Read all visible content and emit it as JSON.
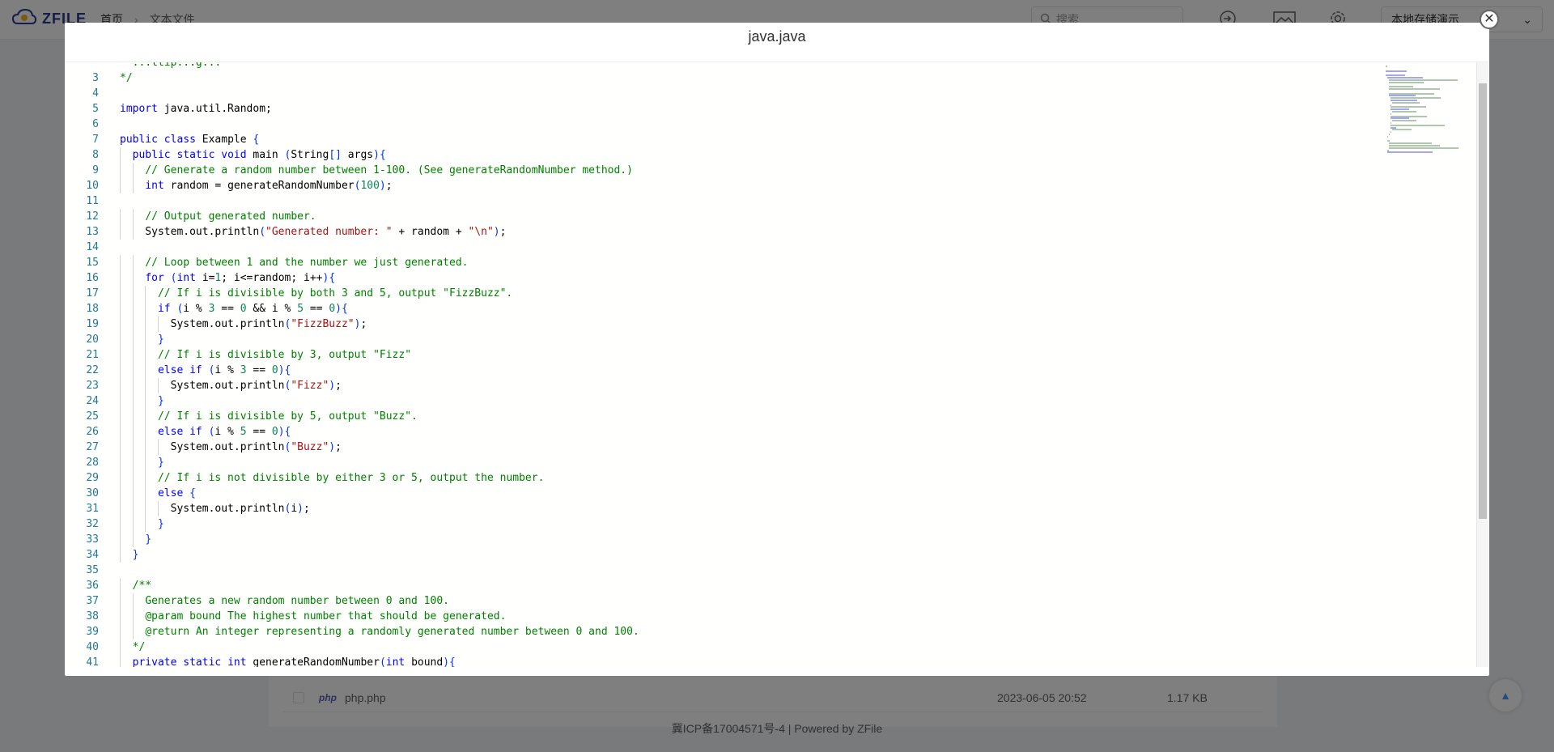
{
  "app": {
    "logo_text": "ZFILE",
    "breadcrumb": [
      "首页",
      "文本文件"
    ],
    "search_placeholder": "搜索",
    "storage_selected": "本地存储演示"
  },
  "file_row": {
    "icon_label": "php",
    "name": "php.php",
    "date": "2023-06-05 20:52",
    "size": "1.17 KB"
  },
  "footer": {
    "text": "冀ICP备17004571号-4 | Powered by ZFile"
  },
  "dialog": {
    "title": "java.java",
    "close_icon": "close-icon"
  },
  "editor": {
    "language": "java",
    "first_line_partial": "* ...ttip...g...",
    "lines": [
      {
        "n": "3",
        "t": "*/"
      },
      {
        "n": "4",
        "t": ""
      },
      {
        "n": "5",
        "t": "import java.util.Random;"
      },
      {
        "n": "6",
        "t": ""
      },
      {
        "n": "7",
        "t": "public class Example {"
      },
      {
        "n": "8",
        "t": "  public static void main (String[] args){"
      },
      {
        "n": "9",
        "t": "    // Generate a random number between 1-100. (See generateRandomNumber method.)"
      },
      {
        "n": "10",
        "t": "    int random = generateRandomNumber(100);"
      },
      {
        "n": "11",
        "t": ""
      },
      {
        "n": "12",
        "t": "    // Output generated number."
      },
      {
        "n": "13",
        "t": "    System.out.println(\"Generated number: \" + random + \"\\n\");"
      },
      {
        "n": "14",
        "t": ""
      },
      {
        "n": "15",
        "t": "    // Loop between 1 and the number we just generated."
      },
      {
        "n": "16",
        "t": "    for (int i=1; i<=random; i++){"
      },
      {
        "n": "17",
        "t": "      // If i is divisible by both 3 and 5, output \"FizzBuzz\"."
      },
      {
        "n": "18",
        "t": "      if (i % 3 == 0 && i % 5 == 0){"
      },
      {
        "n": "19",
        "t": "        System.out.println(\"FizzBuzz\");"
      },
      {
        "n": "20",
        "t": "      }"
      },
      {
        "n": "21",
        "t": "      // If i is divisible by 3, output \"Fizz\""
      },
      {
        "n": "22",
        "t": "      else if (i % 3 == 0){"
      },
      {
        "n": "23",
        "t": "        System.out.println(\"Fizz\");"
      },
      {
        "n": "24",
        "t": "      }"
      },
      {
        "n": "25",
        "t": "      // If i is divisible by 5, output \"Buzz\"."
      },
      {
        "n": "26",
        "t": "      else if (i % 5 == 0){"
      },
      {
        "n": "27",
        "t": "        System.out.println(\"Buzz\");"
      },
      {
        "n": "28",
        "t": "      }"
      },
      {
        "n": "29",
        "t": "      // If i is not divisible by either 3 or 5, output the number."
      },
      {
        "n": "30",
        "t": "      else {"
      },
      {
        "n": "31",
        "t": "        System.out.println(i);"
      },
      {
        "n": "32",
        "t": "      }"
      },
      {
        "n": "33",
        "t": "    }"
      },
      {
        "n": "34",
        "t": "  }"
      },
      {
        "n": "35",
        "t": ""
      },
      {
        "n": "36",
        "t": "  /**"
      },
      {
        "n": "37",
        "t": "    Generates a new random number between 0 and 100."
      },
      {
        "n": "38",
        "t": "    @param bound The highest number that should be generated."
      },
      {
        "n": "39",
        "t": "    @return An integer representing a randomly generated number between 0 and 100."
      },
      {
        "n": "40",
        "t": "  */"
      },
      {
        "n": "41",
        "t": "  private static int generateRandomNumber(int bound){"
      }
    ]
  }
}
